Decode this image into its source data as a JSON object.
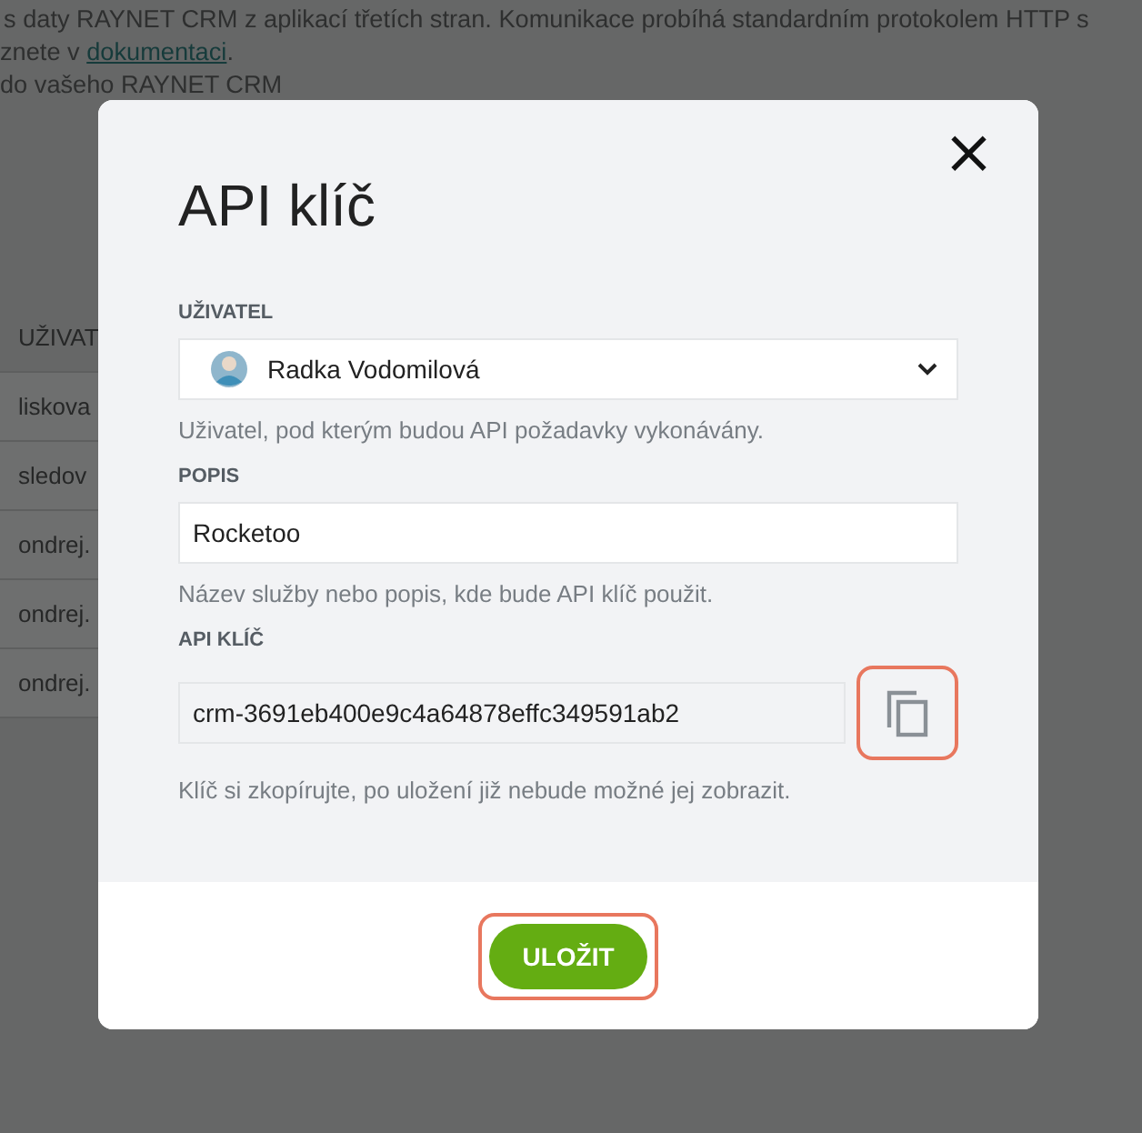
{
  "background": {
    "intro_line": "s daty RAYNET CRM z aplikací třetích stran. Komunikace probíhá standardním protokolem HTTP s",
    "doc_prefix": "znete v ",
    "doc_link": "dokumentaci",
    "doc_suffix": ".",
    "third_line": "do vašeho RAYNET CRM",
    "table": {
      "header": "UŽIVAT",
      "rows": [
        "liskova",
        "sledov",
        "ondrej.",
        "ondrej.",
        "ondrej."
      ]
    }
  },
  "dialog": {
    "title": "API klíč",
    "close": "×",
    "fields": [
      {
        "kind": "select",
        "label": "UŽIVATEL",
        "value": "Radka Vodomilová",
        "hint": "Uživatel, pod kterým budou API požadavky vykonávány."
      },
      {
        "kind": "text",
        "label": "POPIS",
        "value": "Rocketoo",
        "hint": "Název služby nebo popis, kde bude API klíč použit."
      },
      {
        "kind": "key",
        "label": "API KLÍČ",
        "value": "crm-3691eb400e9c4a64878effc349591ab2",
        "hint": "Klíč si zkopírujte, po uložení již nebude možné jej zobrazit.",
        "highlighted": true
      }
    ],
    "save": {
      "label": "ULOŽIT",
      "highlighted": true
    }
  }
}
